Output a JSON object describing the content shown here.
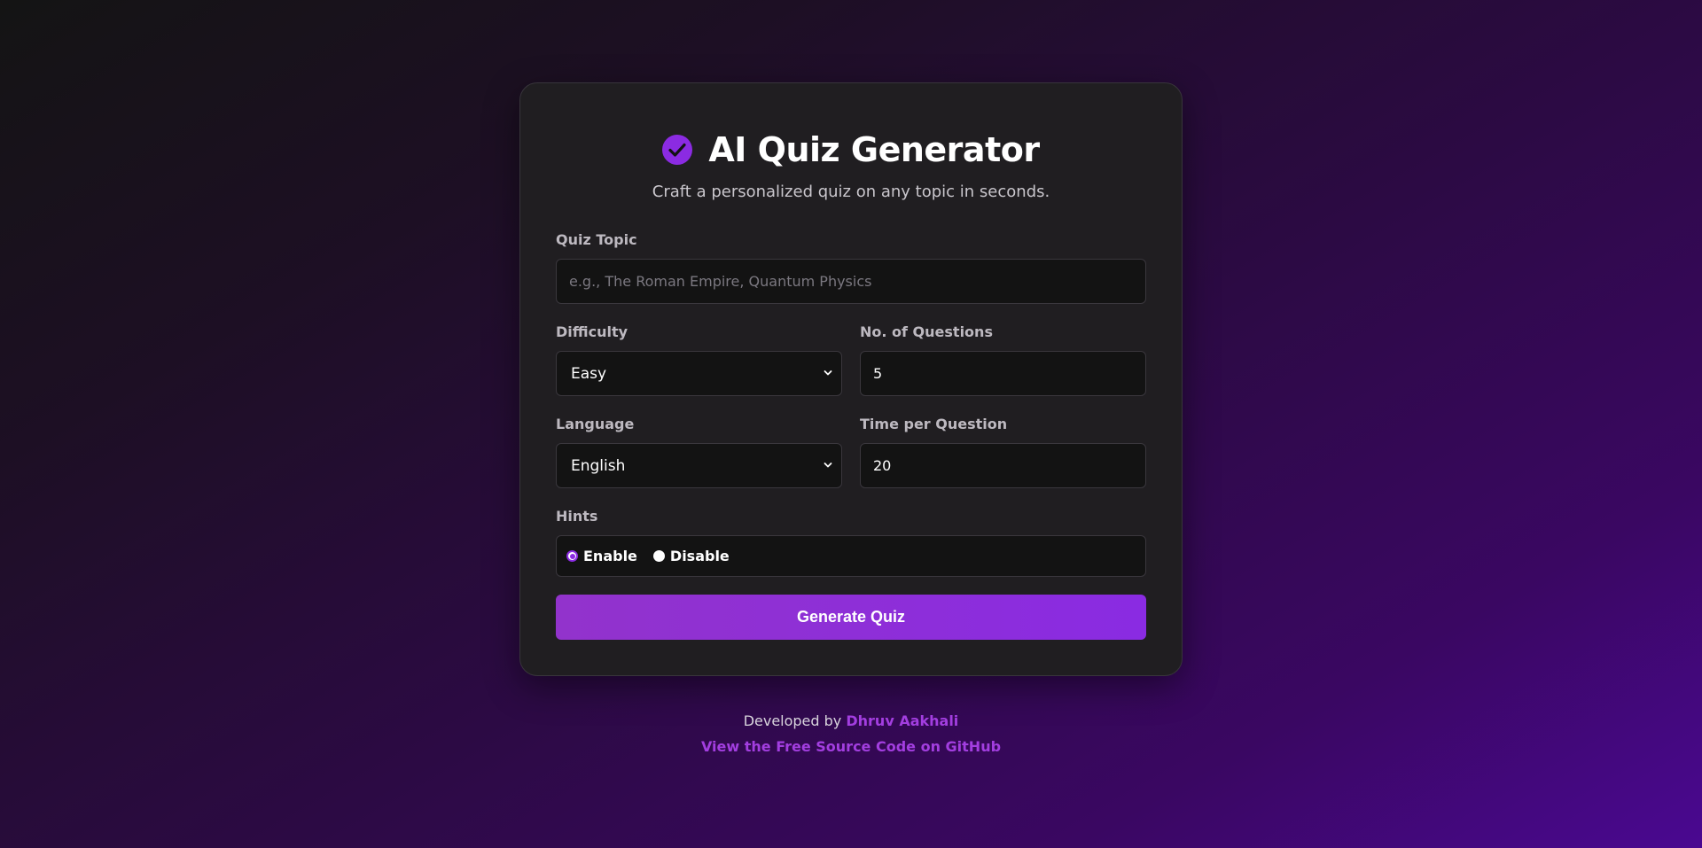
{
  "header": {
    "title": "AI Quiz Generator",
    "subtitle": "Craft a personalized quiz on any topic in seconds.",
    "icon": "check-circle-icon"
  },
  "form": {
    "topic": {
      "label": "Quiz Topic",
      "placeholder": "e.g., The Roman Empire, Quantum Physics",
      "value": ""
    },
    "difficulty": {
      "label": "Difficulty",
      "value": "Easy"
    },
    "num_questions": {
      "label": "No. of Questions",
      "value": "5"
    },
    "language": {
      "label": "Language",
      "value": "English"
    },
    "time_per_question": {
      "label": "Time per Question",
      "value": "20"
    },
    "hints": {
      "label": "Hints",
      "options": [
        "Enable",
        "Disable"
      ],
      "selected": "Enable"
    },
    "submit_label": "Generate Quiz"
  },
  "footer": {
    "developed_by": "Developed by",
    "author": "Dhruv Aakhali",
    "source_link": "View the Free Source Code on GitHub"
  },
  "colors": {
    "accent": "#8b2be2",
    "card_bg": "#201e21",
    "input_bg": "#131313"
  }
}
